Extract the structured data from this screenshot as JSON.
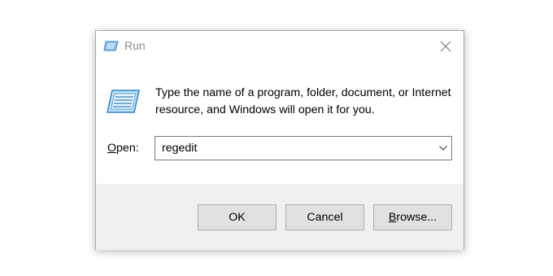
{
  "window": {
    "title": "Run",
    "icon": "run-icon",
    "close_icon": "close-icon"
  },
  "instruction": "Type the name of a program, folder, document, or Internet resource, and Windows will open it for you.",
  "open": {
    "label_accel": "O",
    "label_rest": "pen:",
    "value": "regedit",
    "dropdown_icon": "chevron-down-icon"
  },
  "buttons": {
    "ok": "OK",
    "cancel": "Cancel",
    "browse_accel": "B",
    "browse_rest": "rowse..."
  }
}
